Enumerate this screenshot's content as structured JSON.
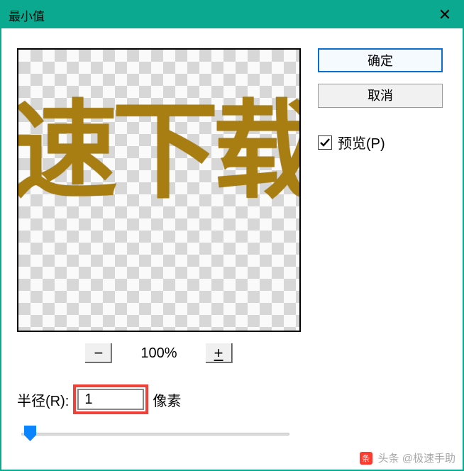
{
  "dialog": {
    "title": "最小值",
    "preview_text": "速下载",
    "zoom_value": "100%",
    "radius": {
      "label": "半径(R):",
      "value": "1",
      "unit": "像素"
    }
  },
  "buttons": {
    "ok": "确定",
    "cancel": "取消"
  },
  "preview_checkbox": {
    "label": "预览(P)",
    "checked": true
  },
  "watermark": {
    "logo_text": "头条",
    "text": "头条 @极速手助"
  }
}
